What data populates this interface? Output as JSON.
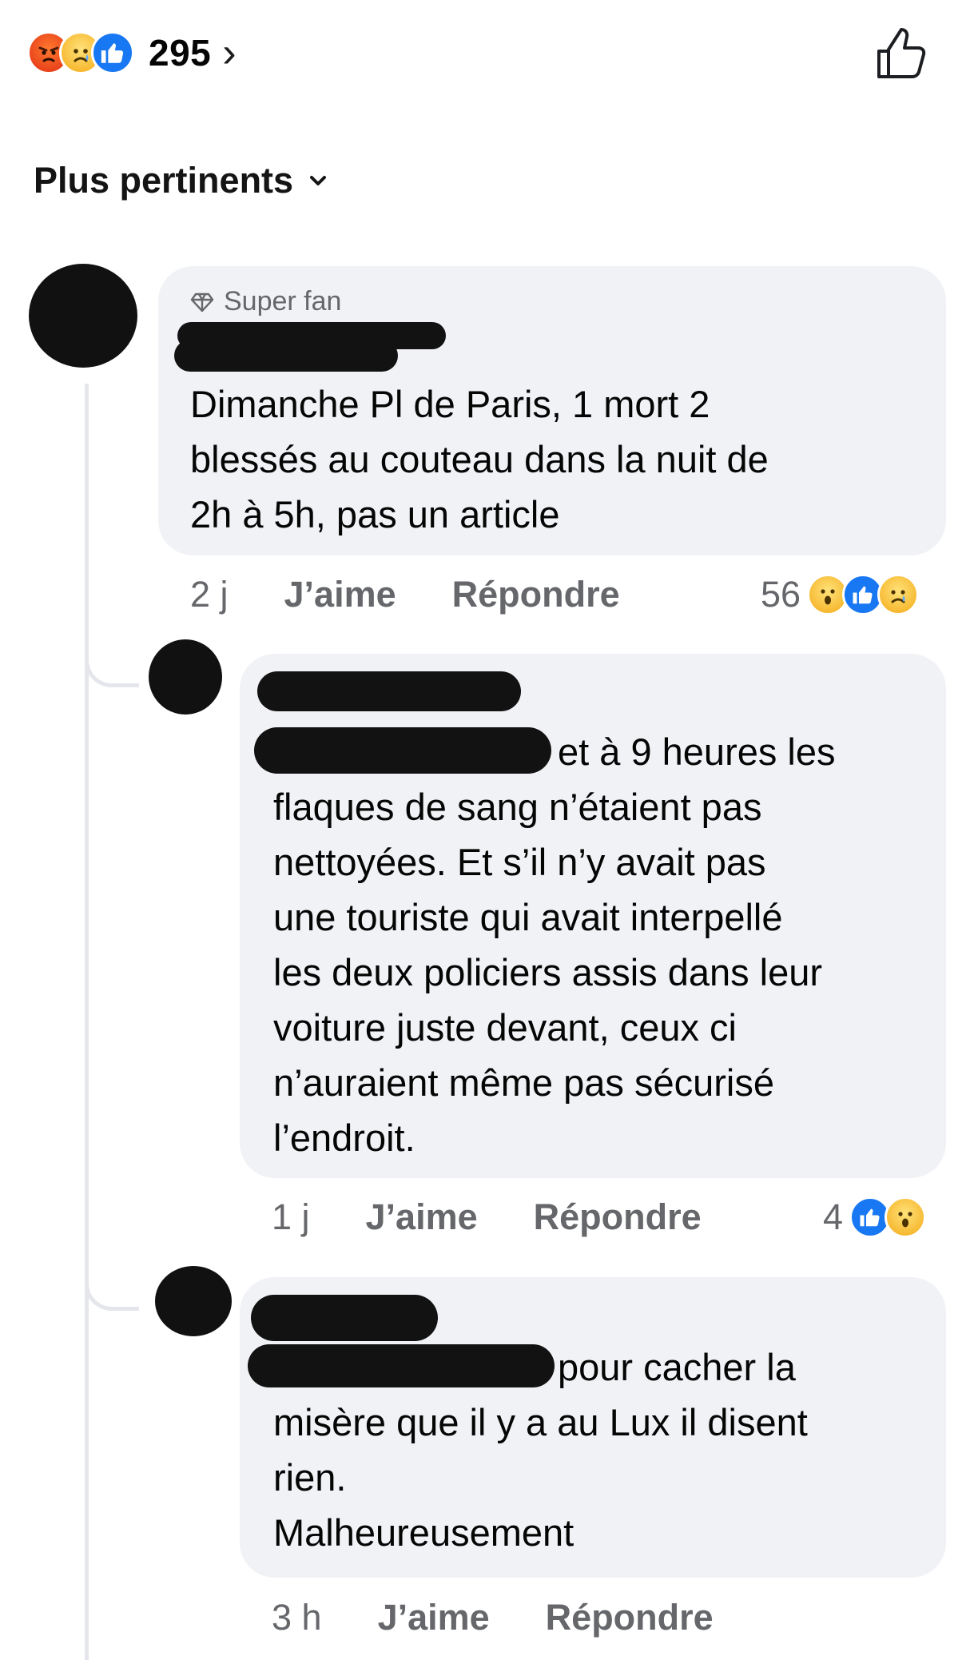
{
  "reactions_summary": {
    "icons": [
      "angry-emoji",
      "sad-emoji",
      "like-icon"
    ],
    "count": "295",
    "chevron": "›"
  },
  "sort": {
    "label": "Plus pertinents",
    "icon": "chevron-down-icon"
  },
  "comments": [
    {
      "badge": "Super fan",
      "text": "Dimanche Pl de Paris, 1 mort 2\nblessés au couteau dans la nuit de\n2h à 5h, pas un article",
      "time": "2 j",
      "like_label": "J’aime",
      "reply_label": "Répondre",
      "reaction_count": "56",
      "reactions": [
        "wow-emoji",
        "like-icon",
        "sad-emoji"
      ]
    },
    {
      "text_first_line": "et à 9 heures les",
      "text": "flaques de sang n’étaient pas\nnettoyées. Et s’il n’y avait pas\nune touriste qui avait interpellé\nles deux policiers assis dans leur\nvoiture juste devant, ceux ci\nn’auraient même pas sécurisé\nl’endroit.",
      "time": "1 j",
      "like_label": "J’aime",
      "reply_label": "Répondre",
      "reaction_count": "4",
      "reactions": [
        "like-icon",
        "wow-emoji"
      ]
    },
    {
      "text_first_line": "pour cacher la",
      "text": "misère que il y a au Lux il disent\nrien.\nMalheureusement",
      "time": "3 h",
      "like_label": "J’aime",
      "reply_label": "Répondre"
    }
  ],
  "colors": {
    "bubble": "#f0f2f5",
    "meta": "#65676b",
    "like_blue": "#1877f2",
    "text": "#050505"
  }
}
